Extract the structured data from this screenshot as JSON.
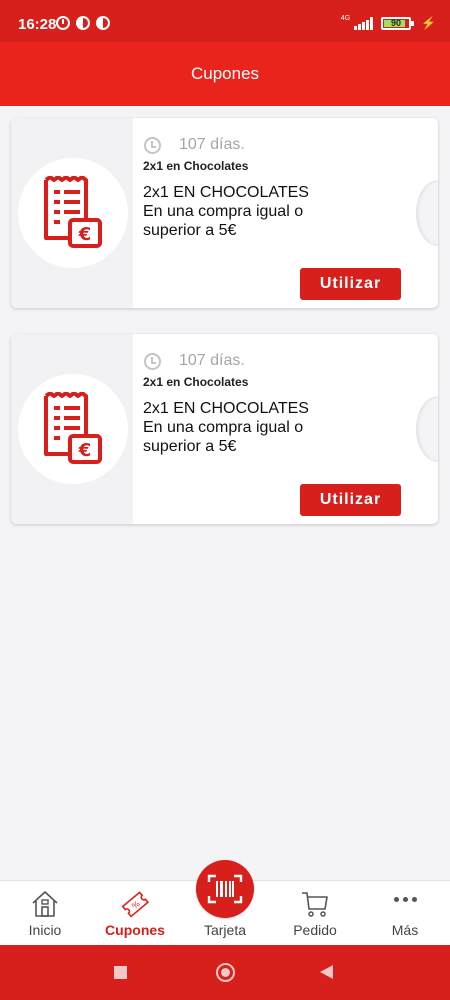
{
  "status_bar": {
    "time": "16:28",
    "network": "4G",
    "battery": "90",
    "battery_level": 0.9
  },
  "header": {
    "title": "Cupones"
  },
  "coupons": [
    {
      "days": "107 días.",
      "subtitle": "2x1 en Chocolates",
      "title_line": "2x1 EN CHOCOLATES",
      "desc_line1": "En una compra igual o",
      "desc_line2": "superior a 5€",
      "button_label": "Utilizar",
      "icon": "receipt-euro-icon"
    },
    {
      "days": "107 días.",
      "subtitle": "2x1 en Chocolates",
      "title_line": "2x1 EN CHOCOLATES",
      "desc_line1": "En una compra igual o",
      "desc_line2": "superior a 5€",
      "button_label": "Utilizar",
      "icon": "receipt-euro-icon"
    }
  ],
  "bottom_nav": {
    "items": [
      {
        "label": "Inicio",
        "icon": "home-icon"
      },
      {
        "label": "Cupones",
        "icon": "coupon-icon",
        "active": true
      },
      {
        "label": "Tarjeta",
        "icon": "barcode-scan-icon"
      },
      {
        "label": "Pedido",
        "icon": "cart-icon"
      },
      {
        "label": "Más",
        "icon": "more-dots-icon"
      }
    ]
  },
  "colors": {
    "brand_red": "#d7201c",
    "header_red": "#e8241d",
    "background": "#f4f3f5",
    "battery_green": "#9be35a"
  }
}
